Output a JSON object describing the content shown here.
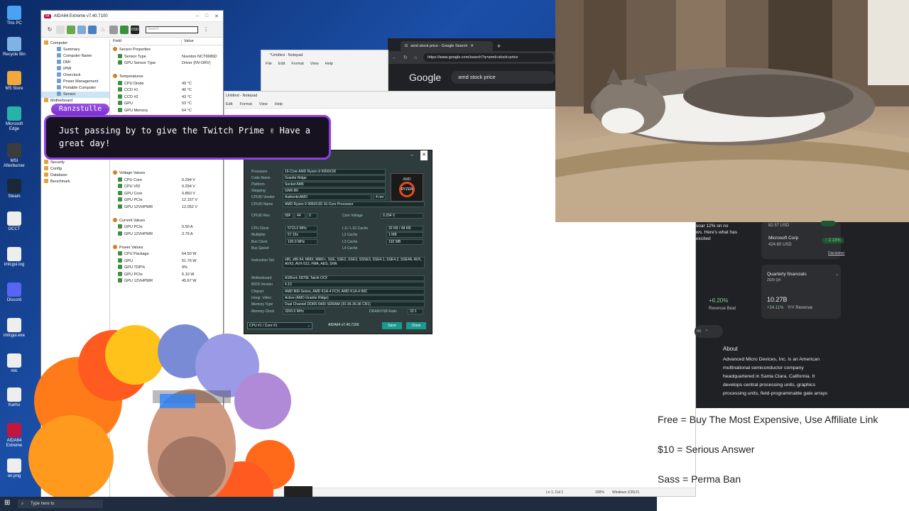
{
  "desktop_icons": [
    {
      "label": "This PC",
      "icon": "pc-icon",
      "color": "#4aa3f0"
    },
    {
      "label": "Recycle Bin",
      "icon": "recycle-bin-icon",
      "color": "#7fb3e6"
    },
    {
      "label": "MS Store",
      "icon": "store-icon",
      "color": "#f2a93b"
    },
    {
      "label": "Microsoft Edge",
      "icon": "edge-icon",
      "color": "#27b4a7"
    },
    {
      "label": "MSI Afterburner",
      "icon": "afterburner-icon",
      "color": "#3c3c3c"
    },
    {
      "label": "Steam",
      "icon": "steam-icon",
      "color": "#1b2838"
    },
    {
      "label": "OCCT",
      "icon": "file-icon",
      "color": "#eeeeee"
    },
    {
      "label": "imlcgui.log",
      "icon": "file-icon",
      "color": "#eeeeee"
    },
    {
      "label": "Discord",
      "icon": "discord-icon",
      "color": "#5865f2"
    },
    {
      "label": "imlcgui.exe",
      "icon": "file-icon",
      "color": "#eeeeee"
    },
    {
      "label": "mlc",
      "icon": "file-icon",
      "color": "#eeeeee"
    },
    {
      "label": "Karhu",
      "icon": "file-icon",
      "color": "#eeeeee"
    },
    {
      "label": "AIDA64 Extreme",
      "icon": "aida64-icon",
      "color": "#c4163d"
    },
    {
      "label": "on.png",
      "icon": "file-icon",
      "color": "#eeeeee"
    }
  ],
  "aida": {
    "title": "AIDA64 Extreme v7.40.7100",
    "badge": "64",
    "search_placeholder": "Search",
    "tree": [
      {
        "label": "Computer",
        "indent": 1
      },
      {
        "label": "Summary",
        "indent": 2
      },
      {
        "label": "Computer Name",
        "indent": 2
      },
      {
        "label": "DMI",
        "indent": 2
      },
      {
        "label": "IPMI",
        "indent": 2
      },
      {
        "label": "Overclock",
        "indent": 2
      },
      {
        "label": "Power Management",
        "indent": 2
      },
      {
        "label": "Portable Computer",
        "indent": 2
      },
      {
        "label": "Sensor",
        "indent": 2,
        "selected": true
      },
      {
        "label": "Motherboard",
        "indent": 1
      }
    ],
    "tree_lower": [
      {
        "label": "Security",
        "indent": 1
      },
      {
        "label": "Config",
        "indent": 1
      },
      {
        "label": "Database",
        "indent": 1
      },
      {
        "label": "Benchmark",
        "indent": 1
      }
    ],
    "col_field": "Field",
    "col_value": "Value",
    "rows_top": [
      {
        "field": "Sensor Properties",
        "value": "",
        "section": true
      },
      {
        "field": "Sensor Type",
        "value": "Nuvoton NCT6686D"
      },
      {
        "field": "GPU Sensor Type",
        "value": "Driver (NV-DRV)"
      },
      {
        "field": "",
        "value": ""
      },
      {
        "field": "Temperatures",
        "value": "",
        "section": true
      },
      {
        "field": "CPU Diode",
        "value": "49 °C"
      },
      {
        "field": "CCD #1",
        "value": "40 °C"
      },
      {
        "field": "CCD #2",
        "value": "43 °C"
      },
      {
        "field": "GPU",
        "value": "53 °C"
      },
      {
        "field": "GPU Memory",
        "value": "64 °C"
      }
    ],
    "rows_voltage": [
      {
        "field": "Voltage Values",
        "value": "",
        "section": true
      },
      {
        "field": "CPU Core",
        "value": "0.294 V"
      },
      {
        "field": "CPU VID",
        "value": "0.294 V"
      },
      {
        "field": "GPU Core",
        "value": "0.860 V"
      },
      {
        "field": "GPU PCIe",
        "value": "12.157 V"
      },
      {
        "field": "GPU 12VHPWR",
        "value": "12.052 V"
      },
      {
        "field": "",
        "value": ""
      },
      {
        "field": "Current Values",
        "value": "",
        "section": true
      },
      {
        "field": "GPU PCIe",
        "value": "0.50 A"
      },
      {
        "field": "GPU 12VHPWR",
        "value": "3.79 A"
      },
      {
        "field": "",
        "value": ""
      },
      {
        "field": "Power Values",
        "value": "",
        "section": true
      },
      {
        "field": "CPU Package",
        "value": "64.50 W"
      },
      {
        "field": "GPU",
        "value": "51.76 W"
      },
      {
        "field": "GPU TDP%",
        "value": "9%"
      },
      {
        "field": "GPU PCIe",
        "value": "6.10 W"
      },
      {
        "field": "GPU 12VHPWR",
        "value": "45.67 W"
      }
    ]
  },
  "notepad_back": {
    "title": "*Untitled - Notepad",
    "menu": [
      "File",
      "Edit",
      "Format",
      "View",
      "Help"
    ]
  },
  "notepad_front": {
    "title": "Untitled - Notepad",
    "menu": [
      "Edit",
      "Format",
      "View",
      "Help"
    ],
    "status_pos": "Ln 1, Col 1",
    "status_zoom": "100%",
    "status_eol": "Windows (CRLF)"
  },
  "browser": {
    "tab_title": "amd stock price - Google Search",
    "url": "https://www.google.com/search?q=amd+stock+price",
    "logo": "Google",
    "query": "amd stock price"
  },
  "cpuid": {
    "processor_label": "Processor",
    "processor": "16-Core AMD Ryzen 9 9950X3D",
    "code_name_label": "Code Name",
    "code_name": "Granite Ridge",
    "platform_label": "Platform",
    "platform": "Socket AM5",
    "stepping_label": "Stepping",
    "stepping": "GNR-B0",
    "vendor_label": "CPUID Vendor",
    "vendor": "AuthenticAMD",
    "process": "4 nm",
    "cpuid_name_label": "CPUID Name",
    "cpuid_name": "AMD Ryzen 9 9950X3D 16-Core Processor",
    "logo_top": "AMD",
    "logo_ring": "RYZEN",
    "rev_label": "CPUID Rev.",
    "rev": [
      "00F",
      "44",
      "0"
    ],
    "core_voltage_label": "Core Voltage",
    "core_voltage": "0.294 V",
    "cpu_clock_label": "CPU Clock",
    "cpu_clock": "5715.0 MHz",
    "multiplier_label": "Multiplier",
    "multiplier": "57.15x",
    "bus_clock_label": "Bus Clock",
    "bus_clock": "100.0 MHz",
    "bus_speed_label": "Bus Speed",
    "l1_label": "L1I / L1D Cache",
    "l1": "32 KB / 48 KB",
    "l2_label": "L2 Cache",
    "l2": "1 MB",
    "l3_label": "L3 Cache",
    "l3": "192 MB",
    "l4_label": "L4 Cache",
    "instr_label": "Instruction Set",
    "instr": "x86, x86-64, MMX, MMX+, SSE, SSE2, SSE3, SSSE3, SSE4.1, SSE4.2, SSE4A, AVX, AVX2, AVX-512, FMA, AES, SHA",
    "mobo_label": "Motherboard",
    "mobo": "ASRock X870E Taichi OCF",
    "bios_label": "BIOS Version",
    "bios": "4.10",
    "chipset_label": "Chipset",
    "chipset": "AMD 800-Series, AMD K1A-4 FCH, AMD K1A.4 IMC",
    "video_label": "Integr. Video",
    "video": "Active (AMD Granite Ridge)",
    "memtype_label": "Memory Type",
    "memtype": "Dual Channel DDR5-6400 SDRAM (30-36-36-36 CR1)",
    "memclock_label": "Memory Clock",
    "memclock": "3200.0 MHz",
    "ratio_label": "DRAM:FSB Ratio",
    "ratio": "32:1",
    "core_select": "CPU #1 / Core #1",
    "version": "AIDA64 v7.40.7100",
    "save": "Save",
    "close": "Close"
  },
  "chat": {
    "user": "Ranzstulle",
    "message": "Just passing by to give the Twitch Prime ✌ Have a great day!"
  },
  "finance": {
    "news_line1": "soar 12% on no",
    "news_line2": "ws. Here's what has",
    "news_line3": "excited",
    "price_top": "82.57 USD",
    "msft_name": "Microsoft Corp",
    "msft_price": "424.60 USD",
    "msft_change": "↑ 2.13%",
    "disclaimer": "Disclaimer",
    "qf_title": "Quarterly financials",
    "qf_period": "2025 Q4",
    "beat_value": "+6.20%",
    "beat_label": "Revenue Beat",
    "rev_value": "10.27B",
    "rev_change": "+34.11%",
    "rev_label": "Y/Y Revenue",
    "link_label": "nc",
    "about_title": "About",
    "about_text_lines": [
      "Advanced Micro Devices, Inc. is an American",
      "multinational semiconductor company",
      "headquartered in Santa Clara, California. It",
      "develops central processing units, graphics",
      "processing units, field-programmable gate arrays"
    ]
  },
  "rules": {
    "line1": "Free = Buy The Most Expensive, Use Affiliate Link",
    "line2": "$10 = Serious Answer",
    "line3": "Sass = Perma Ban"
  },
  "taskbar": {
    "search_placeholder": "Type here to"
  }
}
